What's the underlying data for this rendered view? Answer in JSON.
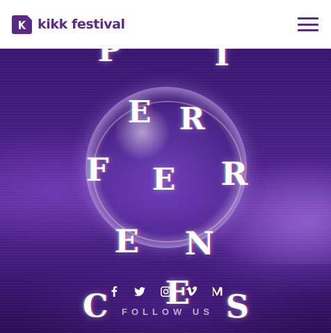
{
  "header": {
    "logo_text": "kikk festival",
    "logo_icon": "kikk-logo-mark",
    "menu_icon": "hamburger-menu-icon"
  },
  "hero": {
    "letters": [
      "P",
      "T",
      "E",
      "R",
      "F",
      "E",
      "R",
      "E",
      "N",
      "C",
      "E",
      "S"
    ],
    "follow_label": "FOLLOW US",
    "social": [
      {
        "icon": "facebook-icon"
      },
      {
        "icon": "twitter-icon"
      },
      {
        "icon": "instagram-icon"
      },
      {
        "icon": "vimeo-icon"
      },
      {
        "icon": "medium-icon"
      }
    ]
  },
  "colors": {
    "brand": "#5a2a86",
    "hero_background": "#4a1f86",
    "text_on_hero": "#ffffff"
  }
}
